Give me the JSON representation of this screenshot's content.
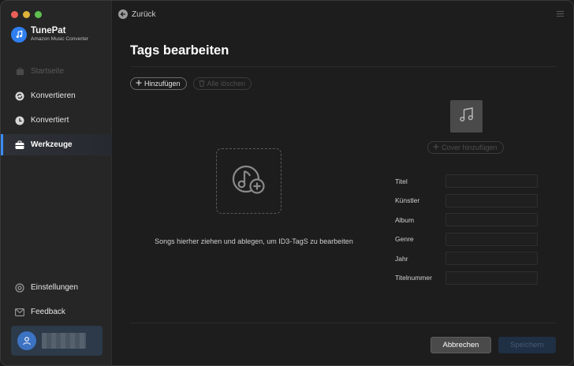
{
  "app": {
    "name": "TunePat",
    "subtitle": "Amazon Music Converter",
    "brand_color": "#2f7ff0"
  },
  "sidebar": {
    "items": [
      {
        "label": "Startseite",
        "icon": "home-icon",
        "state": "disabled"
      },
      {
        "label": "Konvertieren",
        "icon": "convert-icon",
        "state": "normal"
      },
      {
        "label": "Konvertiert",
        "icon": "clock-icon",
        "state": "normal"
      },
      {
        "label": "Werkzeuge",
        "icon": "toolbox-icon",
        "state": "active"
      }
    ],
    "bottom_items": [
      {
        "label": "Einstellungen",
        "icon": "gear-icon"
      },
      {
        "label": "Feedback",
        "icon": "mail-icon"
      }
    ],
    "accent_color": "#3b8cf7"
  },
  "header": {
    "back_label": "Zurück"
  },
  "page": {
    "title": "Tags bearbeiten",
    "add_label": "Hinzufügen",
    "clear_label": "Alle löschen",
    "drop_text": "Songs hierher ziehen und ablegen, um ID3-TagS zu bearbeiten",
    "cover_label": "Cover hinzufügen"
  },
  "fields": [
    {
      "label": "Titel",
      "value": ""
    },
    {
      "label": "Künstler",
      "value": ""
    },
    {
      "label": "Album",
      "value": ""
    },
    {
      "label": "Genre",
      "value": ""
    },
    {
      "label": "Jahr",
      "value": ""
    },
    {
      "label": "Titelnummer",
      "value": ""
    }
  ],
  "footer": {
    "cancel_label": "Abbrechen",
    "save_label": "Speichern"
  }
}
